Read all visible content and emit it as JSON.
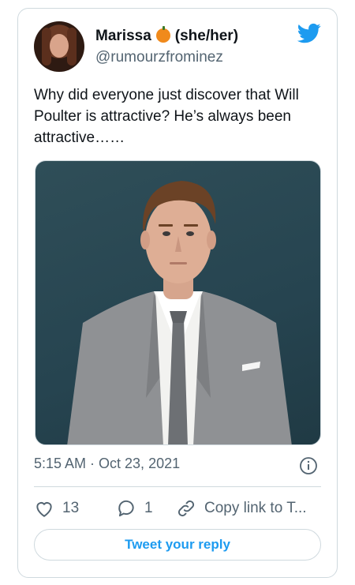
{
  "tweet": {
    "display_name": "Marissa",
    "pronouns": "(she/her)",
    "handle": "@rumourzfrominez",
    "text": "Why did everyone just discover that Will Poulter is attractive? He’s always been attractive……",
    "timestamp": "5:15 AM · Oct 23, 2021"
  },
  "actions": {
    "like_count": "13",
    "reply_count": "1",
    "copy_link_label": "Copy link to T..."
  },
  "reply_button_label": "Tweet your reply",
  "colors": {
    "twitter_blue": "#1d9bf0",
    "secondary_text": "#536471",
    "border": "#cfd9de"
  },
  "icons": [
    "twitter-bird-icon",
    "info-icon",
    "heart-icon",
    "reply-icon",
    "link-icon",
    "pumpkin-emoji-icon"
  ]
}
